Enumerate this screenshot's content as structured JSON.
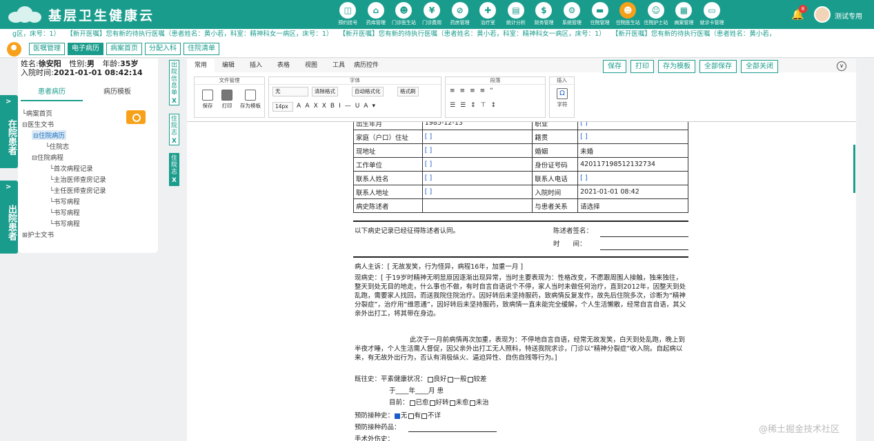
{
  "app": {
    "title": "基层卫生健康云"
  },
  "nav": [
    {
      "label": "预约挂号",
      "icon": "calendar-icon",
      "glyph": "◫"
    },
    {
      "label": "药库管理",
      "icon": "warehouse-icon",
      "glyph": "⌂"
    },
    {
      "label": "门诊医生站",
      "icon": "doctor-icon",
      "glyph": "☻"
    },
    {
      "label": "门诊费用",
      "icon": "coin-icon",
      "glyph": "¥"
    },
    {
      "label": "药房管理",
      "icon": "pill-icon",
      "glyph": "⊘"
    },
    {
      "label": "治疗室",
      "icon": "treatment-icon",
      "glyph": "✚"
    },
    {
      "label": "统计分析",
      "icon": "chart-icon",
      "glyph": "▤"
    },
    {
      "label": "财务管理",
      "icon": "finance-icon",
      "glyph": "$"
    },
    {
      "label": "系统管理",
      "icon": "settings-icon",
      "glyph": "⚙"
    },
    {
      "label": "住院管理",
      "icon": "bed-icon",
      "glyph": "▬"
    },
    {
      "label": "住院医生站",
      "icon": "doctor-icon",
      "glyph": "☻"
    },
    {
      "label": "住院护士站",
      "icon": "nurse-icon",
      "glyph": "☺"
    },
    {
      "label": "病案管理",
      "icon": "file-icon",
      "glyph": "▦"
    },
    {
      "label": "就诊卡管理",
      "icon": "card-icon",
      "glyph": "▭"
    }
  ],
  "header": {
    "badge": "8",
    "user": "测试专用"
  },
  "ticker": [
    "g区，床号：1）",
    "【新开医嘱】您有新的待执行医嘱（患者姓名：黄小若，科室：精神科女一病区，床号：1）",
    "【新开医嘱】您有新的待执行医嘱（患者姓名：黄小若，科室：精神科女一病区，床号：1）",
    "【新开医嘱】您有新的待执行医嘱（患者姓名：黄小若，"
  ],
  "tabs": [
    "医嘱管理",
    "电子病历",
    "病案首页",
    "分配入科",
    "住院清单"
  ],
  "side": {
    "in": "在院患者",
    "out": "出院患者"
  },
  "patient": {
    "name_label": "姓名:",
    "name": "徐安阳",
    "gender_label": "性别:",
    "gender": "男",
    "age_label": "年龄:",
    "age": "35岁",
    "admit_label": "入院时间:",
    "admit": "2021-01-01 08:42:14"
  },
  "left_tabs": [
    "患者病历",
    "病历模板"
  ],
  "tree": [
    "病案首页",
    "医生文书",
    "住院病历",
    "住院志",
    "住院病程",
    "首次病程记录",
    "主治医师查房记录",
    "主任医师查房记录",
    "书写病程",
    "书写病程",
    "书写病程",
    "护士文书"
  ],
  "vtabs": [
    "出院信息单",
    "住院志",
    "住院志"
  ],
  "ribbon_tabs": [
    "常用",
    "编辑",
    "插入",
    "表格",
    "视图",
    "工具",
    "病历控件"
  ],
  "actions": [
    "保存",
    "打印",
    "存为模板",
    "全部保存",
    "全部关闭"
  ],
  "ribbon": {
    "g1": "文件管理",
    "save": "保存",
    "print": "打印",
    "tpl": "存为模板",
    "g2": "字体",
    "font": "无",
    "size": "14px",
    "clear": "清除格式",
    "auto": "自动格式化",
    "brush": "格式刷",
    "g3": "段落",
    "g4": "插入",
    "char": "字符"
  },
  "table": [
    [
      "出生年月",
      "1985-12-13",
      "职业",
      "[ ]"
    ],
    [
      "家庭（户口）住址",
      "[ ]",
      "籍贯",
      "[ ]"
    ],
    [
      "现地址",
      "[ ]",
      "婚姻",
      "未婚"
    ],
    [
      "工作单位",
      "[ ]",
      "身份证号码",
      "420117198512132734"
    ],
    [
      "联系人姓名",
      "[ ]",
      "联系人电话",
      "[ ]"
    ],
    [
      "联系人地址",
      "[ ]",
      "入院时间",
      "2021-01-01 08:42"
    ],
    [
      "病史陈述者",
      "",
      "与患者关系",
      "请选择"
    ]
  ],
  "doc": {
    "confirm": "以下病史记录已经征得陈述者认同。",
    "sign": "陈述者签名：",
    "time": "时　　间：",
    "chief": "病人主诉：[ 无故发笑，行为怪异，病程16年，加重一月 ]",
    "hpi1": "现病史：[ 于19岁时精神无明显原因逐渐出现异常，当时主要表现为：性格改变，不愿跟周围人接触，独来独往，整天到处无目的地走，什么事也不做，有时自言自语说个不停，家人当时未做任何治疗，直到2012年，因整天到处乱跑，需要家人找回，而送我院住院治疗。因好转后未坚持服药，致病情反复发作，故先后住院多次，诊断为“精神分裂症”，治疗用“维思通”，因好转后未坚持服药，致病情一直未能完全缓解，个人生活懒散，经常自言自语，其父亲外出打工，将其带在身边。",
    "hpi2": "此次于一月前病情再次加重，表现为：不停地自言自语，经常无故发笑，白天到处乱跑，晚上到半夜才睡，个人生活需人督促，因父亲外出打工无人照料，特送我院求诊，门诊以“精神分裂症”收入院。自起病以来，有无故外出行为，否认有消极纵火、逼迫异性、自伤自残等行为。]",
    "past": "既往史：平素健康状况：",
    "opts1": [
      "良好",
      "一般",
      "较差"
    ],
    "year": "于____年____月 患",
    "now": "目前：",
    "opts2": [
      "已愈",
      "好转",
      "未愈",
      "未治"
    ],
    "vacc": "预防接种史：",
    "opts3": [
      "无",
      "有",
      "不详"
    ],
    "vaccdrug": "预防接种药品：",
    "surg": "手术外伤史："
  },
  "watermark": "@稀土掘金技术社区"
}
